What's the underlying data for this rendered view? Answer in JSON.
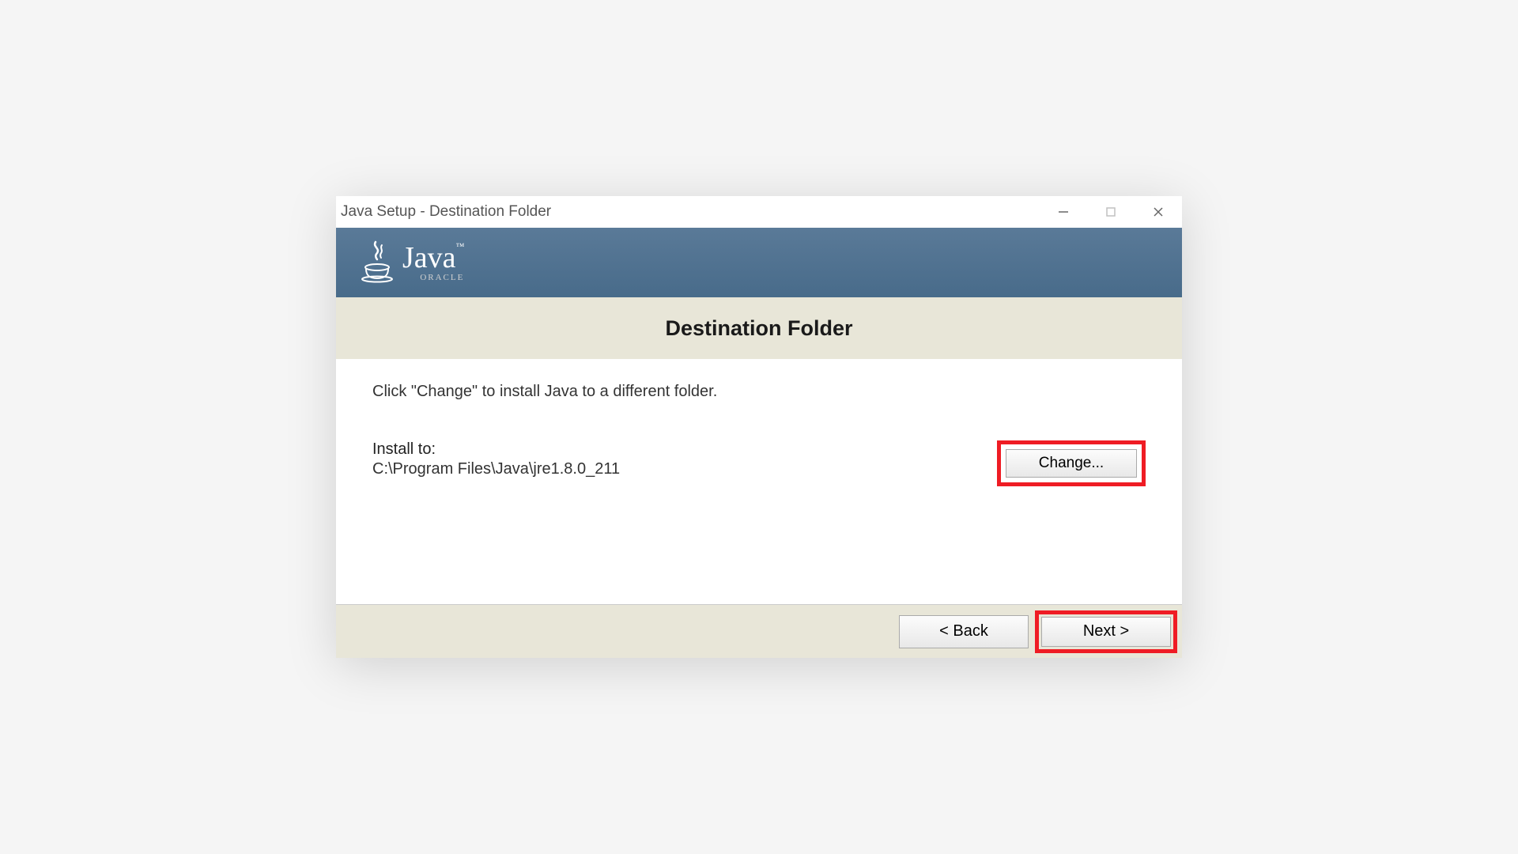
{
  "titlebar": {
    "title": "Java Setup - Destination Folder"
  },
  "logo": {
    "name": "Java",
    "vendor": "ORACLE"
  },
  "heading": "Destination Folder",
  "instruction": "Click \"Change\" to install Java to a different folder.",
  "install": {
    "label": "Install to:",
    "path": "C:\\Program Files\\Java\\jre1.8.0_211"
  },
  "buttons": {
    "change": "Change...",
    "back": "< Back",
    "next": "Next >"
  }
}
